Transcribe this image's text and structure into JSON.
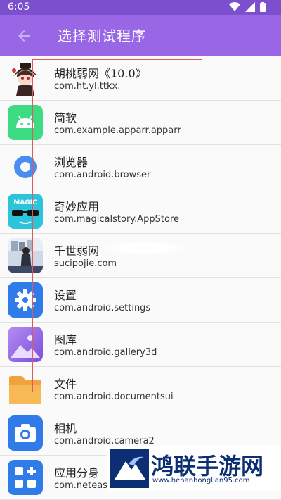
{
  "status_bar": {
    "time": "6:05"
  },
  "header": {
    "title": "选择测试程序"
  },
  "apps": [
    {
      "name": "胡桃弱网《10.0》",
      "package": "com.ht.yl.ttkx."
    },
    {
      "name": "简软",
      "package": "com.example.apparr.apparr"
    },
    {
      "name": "浏览器",
      "package": "com.android.browser"
    },
    {
      "name": "奇妙应用",
      "package": "com.magicalstory.AppStore",
      "icon_text": "MAGIC"
    },
    {
      "name": "千世弱网",
      "package": "sucipojie.com"
    },
    {
      "name": "设置",
      "package": "com.android.settings"
    },
    {
      "name": "图库",
      "package": "com.android.gallery3d"
    },
    {
      "name": "文件",
      "package": "com.android.documentsui"
    },
    {
      "name": "相机",
      "package": "com.android.camera2"
    },
    {
      "name": "应用分身",
      "package": "com.netease"
    }
  ],
  "watermark": {
    "brand": "鸿联手游网",
    "url": "www.henanhonglian95.com"
  },
  "colors": {
    "appbar": "#9966e6",
    "statusbar": "#7c4fcf"
  }
}
